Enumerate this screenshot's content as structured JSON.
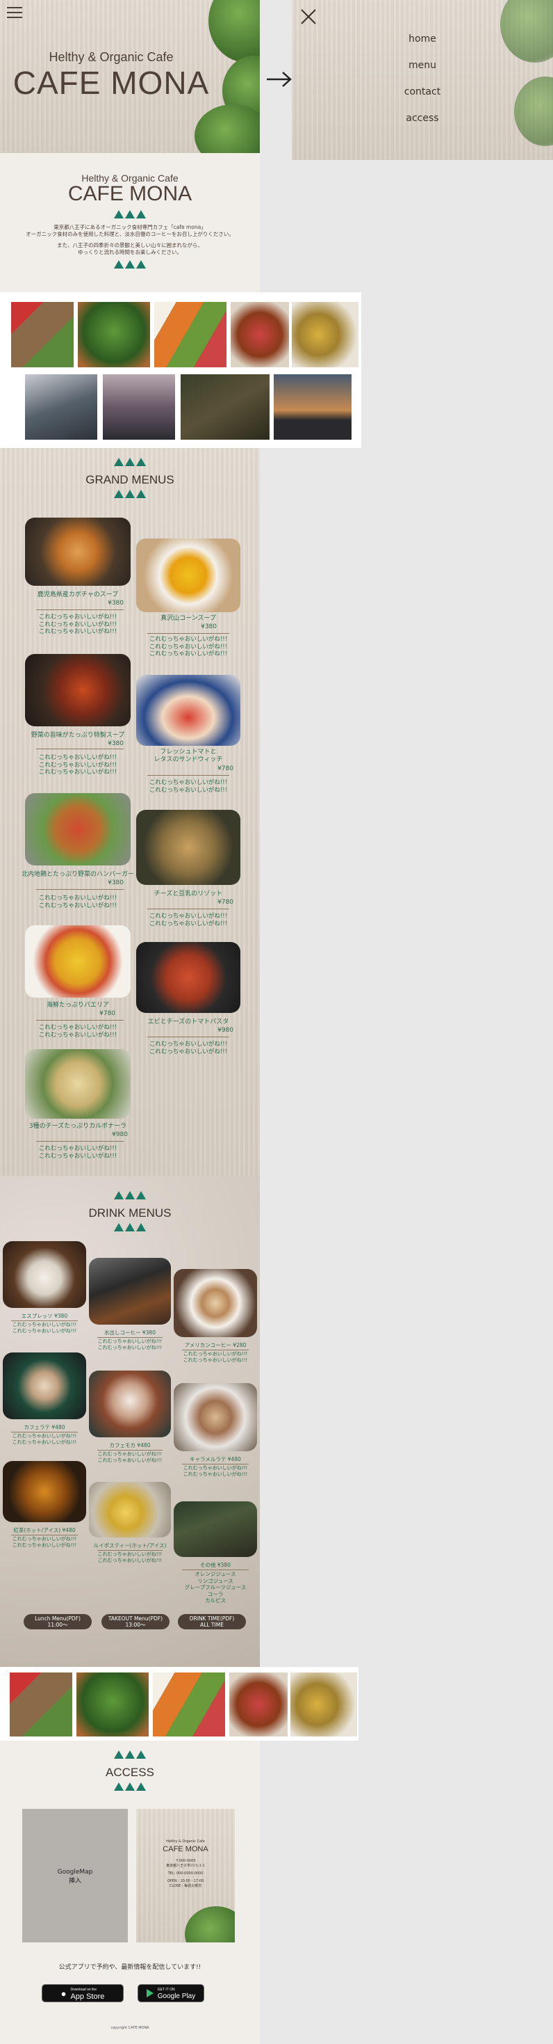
{
  "header": {
    "subtitle": "Helthy & Organic Cafe",
    "title": "CAFE MONA",
    "menu_icon": "hamburger-icon"
  },
  "intro": {
    "subtitle": "Helthy & Organic Cafe",
    "title": "CAFE MONA",
    "line1": "東京都八王子にあるオーガニック食材専門カフェ「cafe mona」",
    "line2": "オーガニック食材のみを使用した料理と、淡水自慢のコーヒーをお召し上がりください。",
    "line3": "また、八王子の四季折々の景観と美しい山々に囲まれながら、",
    "line4": "ゆっくりと流れる時間をお楽しみください。"
  },
  "grand_menus": {
    "title": "GRAND MENUS",
    "items": [
      {
        "name": "鹿児島県産カボチャのスープ",
        "price": "¥380",
        "desc": [
          "これむっちゃおいしいがね!!!",
          "これむっちゃおいしいがね!!!",
          "これむっちゃおいしいがね!!!"
        ]
      },
      {
        "name": "真沢山コーンスープ",
        "price": "¥380",
        "desc": [
          "これむっちゃおいしいがね!!!",
          "これむっちゃおいしいがね!!!",
          "これむっちゃおいしいがね!!!"
        ]
      },
      {
        "name": "野菜の旨味がたっぷり特製スープ",
        "price": "¥380",
        "desc": [
          "これむっちゃおいしいがね!!!",
          "これむっちゃおいしいがね!!!",
          "これむっちゃおいしいがね!!!"
        ]
      },
      {
        "name": "フレッシュトマトと\nレタスのサンドウィッチ",
        "price": "¥780",
        "desc": [
          "これむっちゃおいしいがね!!!",
          "これむっちゃおいしいがね!!!"
        ]
      },
      {
        "name": "北内地鶏とたっぷり野菜のハンバーガー",
        "price": "¥380",
        "desc": [
          "これむっちゃおいしいがね!!!",
          "これむっちゃおいしいがね!!!"
        ]
      },
      {
        "name": "チーズと豆乳のリゾット",
        "price": "¥780",
        "desc": [
          "これむっちゃおいしいがね!!!",
          "これむっちゃおいしいがね!!!"
        ]
      },
      {
        "name": "海鮮たっぷりパエリア",
        "price": "¥780",
        "desc": [
          "これむっちゃおいしいがね!!!",
          "これむっちゃおいしいがね!!!"
        ]
      },
      {
        "name": "エビとチーズのトマトパスタ",
        "price": "¥980",
        "desc": [
          "これむっちゃおいしいがね!!!",
          "これむっちゃおいしいがね!!!"
        ]
      },
      {
        "name": "3種のチーズたっぷりカルボナーラ",
        "price": "¥980",
        "desc": [
          "これむっちゃおいしいがね!!!",
          "これむっちゃおいしいがね!!!"
        ]
      }
    ]
  },
  "drink_menus": {
    "title": "DRINK MENUS",
    "items": [
      {
        "name": "エスプレッソ ¥380",
        "desc": [
          "これむっちゃおいしいがね!!!",
          "これむっちゃおいしいがね!!!"
        ]
      },
      {
        "name": "水出しコーヒー ¥380",
        "desc": [
          "これむっちゃおいしいがね!!!",
          "これむっちゃおいしいがね!!!"
        ]
      },
      {
        "name": "アメリカンコーヒー ¥280",
        "desc": [
          "これむっちゃおいしいがね!!!",
          "これむっちゃおいしいがね!!!"
        ]
      },
      {
        "name": "カフェラテ ¥480",
        "desc": [
          "これむっちゃおいしいがね!!!",
          "これむっちゃおいしいがね!!!"
        ]
      },
      {
        "name": "カフェモカ ¥480",
        "desc": [
          "これむっちゃおいしいがね!!!",
          "これむっちゃおいしいがね!!!"
        ]
      },
      {
        "name": "キャラメルラテ ¥480",
        "desc": [
          "これむっちゃおいしいがね!!!",
          "これむっちゃおいしいがね!!!"
        ]
      },
      {
        "name": "紅茶(ホット/アイス) ¥480",
        "desc": [
          "これむっちゃおいしいがね!!!",
          "これむっちゃおいしいがね!!!"
        ]
      },
      {
        "name": "ルイボスティー(ホット/アイス)",
        "desc": [
          "これむっちゃおいしいがね!!!",
          "これむっちゃおいしいがね!!!"
        ]
      },
      {
        "name": "その他 ¥380",
        "desc": [
          "オレンジジュース",
          "リンゴジュース",
          "グレープフルーツジュース",
          "コーラ",
          "カルピス"
        ]
      }
    ],
    "buttons": [
      {
        "line1": "Lunch Menu(PDF)",
        "line2": "11:00〜"
      },
      {
        "line1": "TAKEOUT Menu(PDF)",
        "line2": "13:00〜"
      },
      {
        "line1": "DRINK TIME(PDF)",
        "line2": "ALL TIME"
      }
    ]
  },
  "access": {
    "title": "ACCESS",
    "map_line1": "GoogleMap",
    "map_line2": "挿入",
    "card_subtitle": "Helthy & Organic Cafe",
    "card_title": "CAFE MONA",
    "card_postal": "〒000-0000",
    "card_address": "東京都八王子市ﾏﾏﾏ1-1-1",
    "card_tel": "TEL: 000-0000-0000",
    "card_open": "OPEN : 10:00 - 17:00",
    "card_close": "CLOSE : 毎週火曜日",
    "app_text": "公式アプリで予約や、最新情報を配信しています!!",
    "appstore_small": "Download on the",
    "appstore": "App Store",
    "googleplay_small": "GET IT ON",
    "googleplay": "Google Play",
    "copyright": "copyright CAFE MONA"
  },
  "nav": {
    "close_icon": "close-icon",
    "arrow_icon": "arrow-right-icon",
    "items": [
      "home",
      "menu",
      "contact",
      "access"
    ]
  },
  "colors": {
    "accent": "#1d7a66",
    "text_green": "#2b6a4d",
    "dark": "#4d4038"
  }
}
